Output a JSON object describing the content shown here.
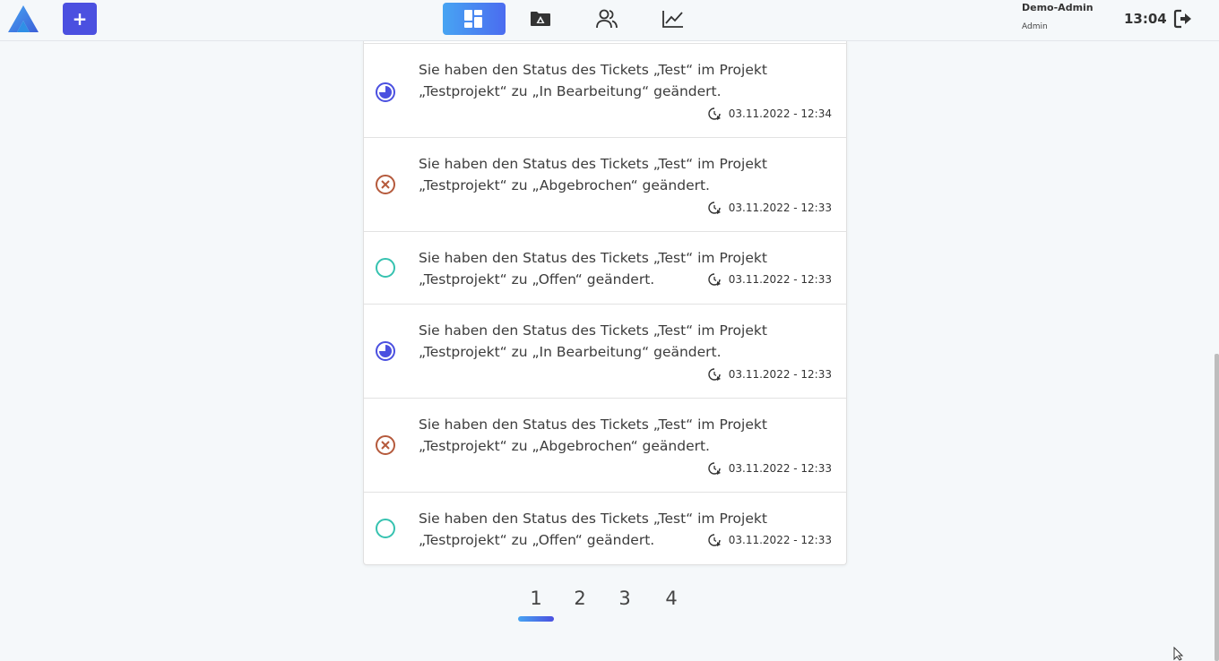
{
  "header": {
    "add_label": "+",
    "user_name": "Demo-Admin",
    "user_role": "Admin",
    "time": "13:04",
    "nav": [
      {
        "name": "dashboard",
        "icon": "dashboard-icon",
        "active": true
      },
      {
        "name": "projects",
        "icon": "folder-icon",
        "active": false
      },
      {
        "name": "users",
        "icon": "users-icon",
        "active": false
      },
      {
        "name": "statistics",
        "icon": "chart-line-icon",
        "active": false
      }
    ]
  },
  "colors": {
    "accent": "#4b50e0",
    "in_progress": "#4b50e0",
    "cancelled": "#b55a3c",
    "open": "#36c2b0"
  },
  "activities": [
    {
      "status": "in-progress",
      "icon": "clock-progress-icon",
      "line1": "Sie haben den Status des Tickets „Test“ im Projekt",
      "line2": "„Testprojekt“ zu „In Bearbeitung“ geändert.",
      "timestamp": "03.11.2022 - 12:34"
    },
    {
      "status": "cancelled",
      "icon": "cancel-circle-icon",
      "line1": "Sie haben den Status des Tickets „Test“ im Projekt",
      "line2": "„Testprojekt“ zu „Abgebrochen“ geändert.",
      "timestamp": "03.11.2022 - 12:33"
    },
    {
      "status": "open",
      "icon": "open-circle-icon",
      "line1": "Sie haben den Status des Tickets „Test“ im Projekt",
      "line2": "„Testprojekt“ zu „Offen“ geändert.",
      "timestamp": "03.11.2022 - 12:33"
    },
    {
      "status": "in-progress",
      "icon": "clock-progress-icon",
      "line1": "Sie haben den Status des Tickets „Test“ im Projekt",
      "line2": "„Testprojekt“ zu „In Bearbeitung“ geändert.",
      "timestamp": "03.11.2022 - 12:33"
    },
    {
      "status": "cancelled",
      "icon": "cancel-circle-icon",
      "line1": "Sie haben den Status des Tickets „Test“ im Projekt",
      "line2": "„Testprojekt“ zu „Abgebrochen“ geändert.",
      "timestamp": "03.11.2022 - 12:33"
    },
    {
      "status": "open",
      "icon": "open-circle-icon",
      "line1": "Sie haben den Status des Tickets „Test“ im Projekt",
      "line2": "„Testprojekt“ zu „Offen“ geändert.",
      "timestamp": "03.11.2022 - 12:33"
    }
  ],
  "pagination": {
    "pages": [
      "1",
      "2",
      "3",
      "4"
    ],
    "current": "1"
  }
}
